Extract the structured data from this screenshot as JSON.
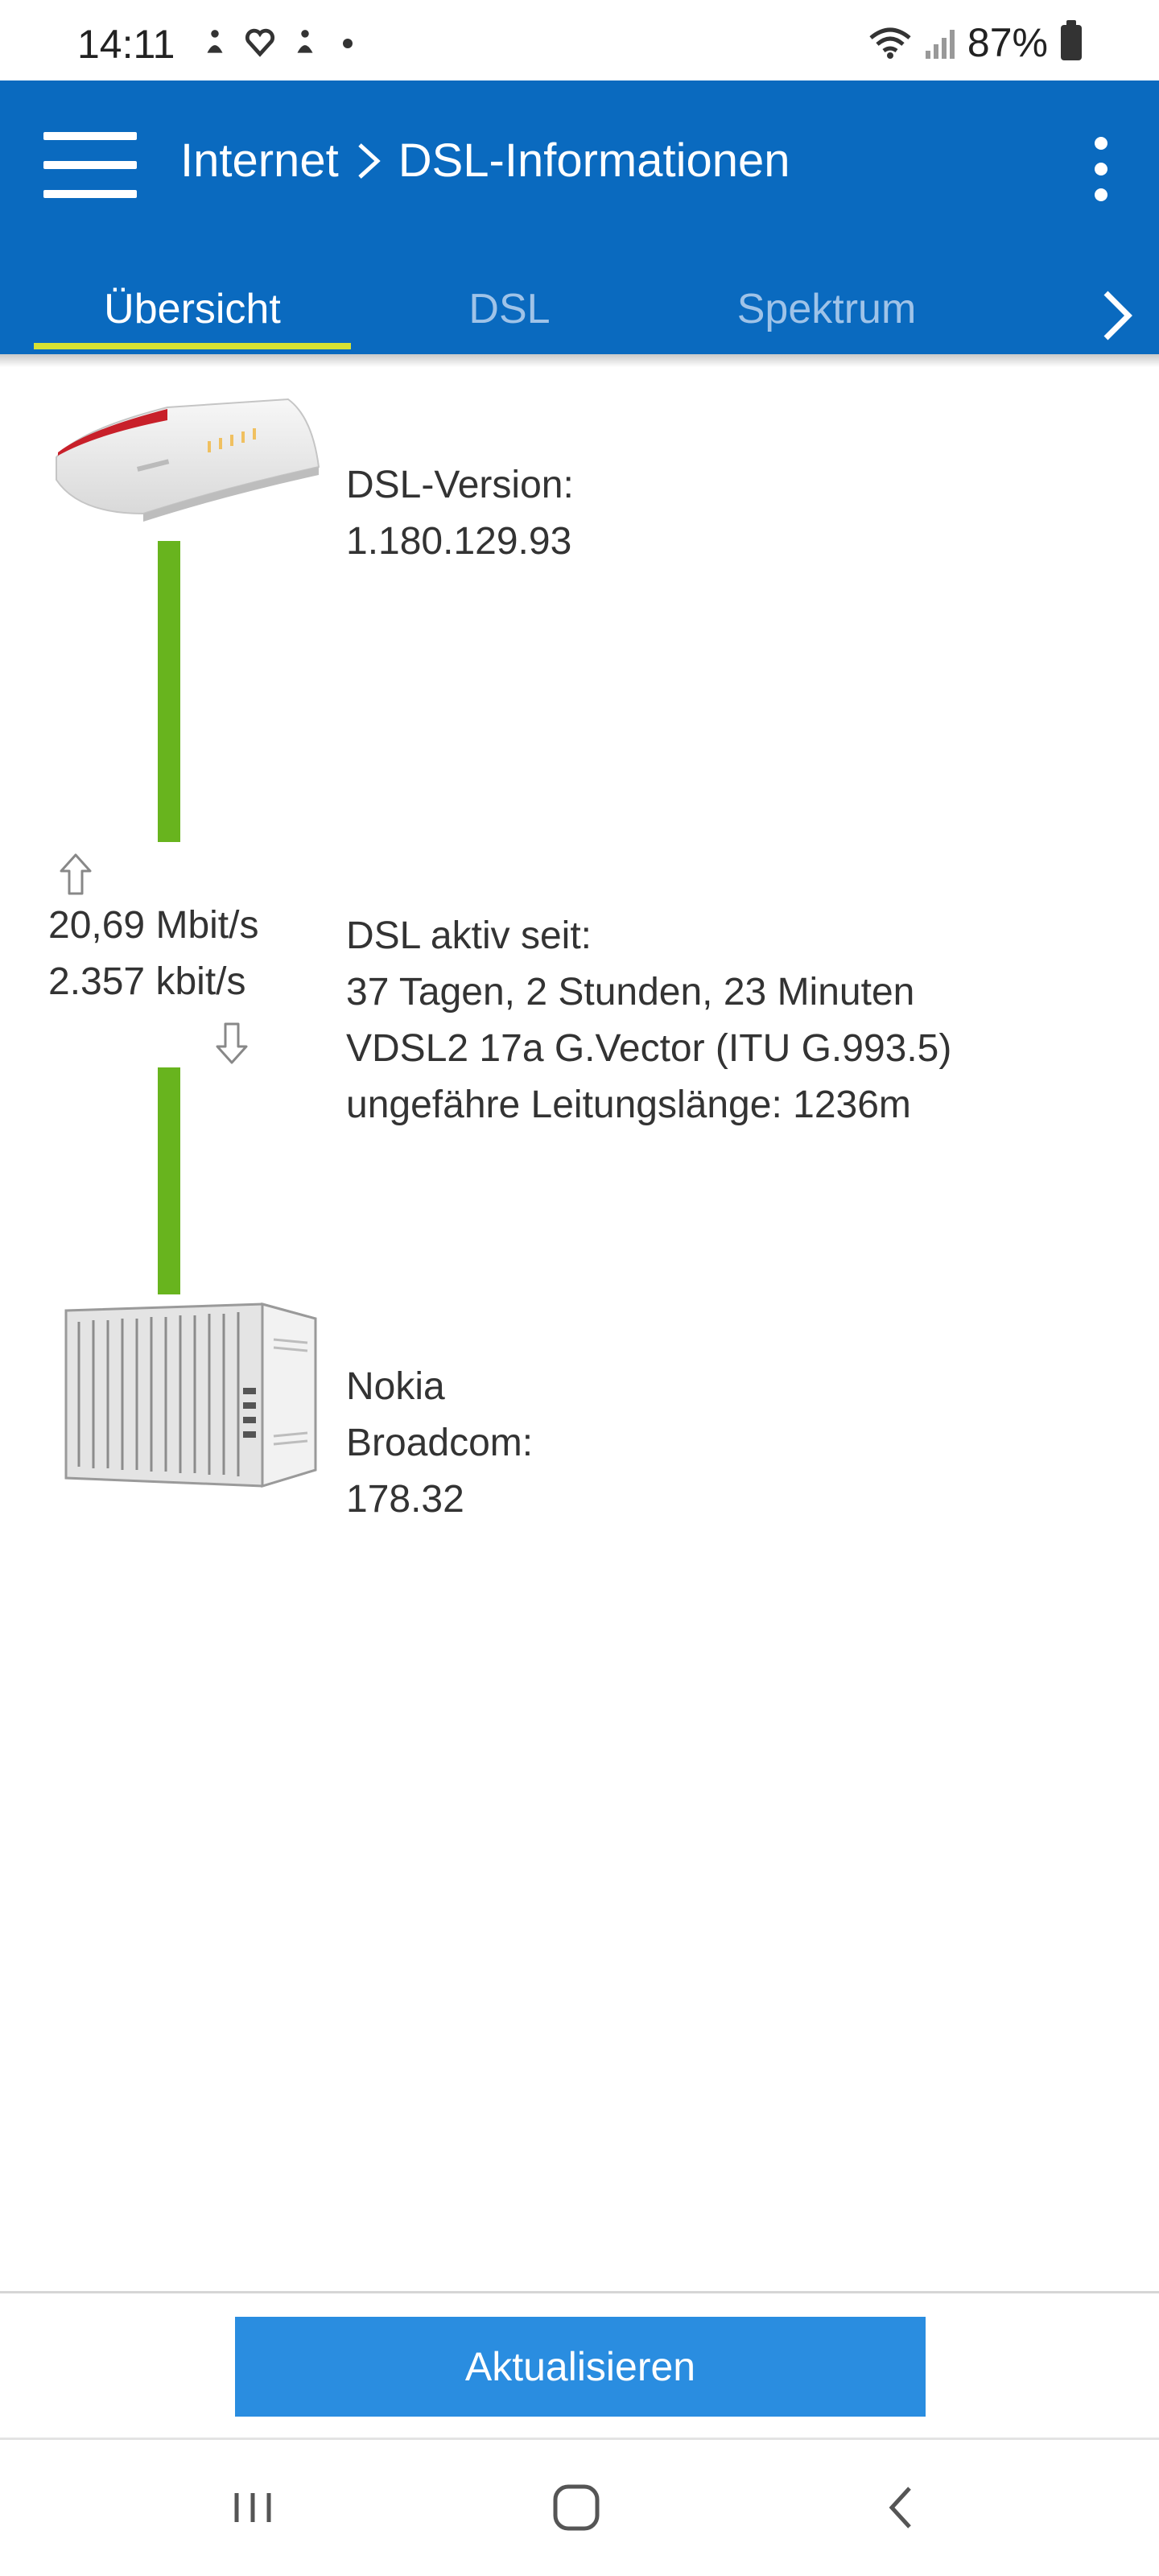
{
  "status_bar": {
    "time": "14:11",
    "battery": "87%",
    "icons": [
      "figure-icon",
      "heart-icon",
      "figure-icon",
      "dot-icon",
      "wifi-icon",
      "signal-icon",
      "battery-icon"
    ]
  },
  "app_bar": {
    "crumb_parent": "Internet",
    "crumb_current": "DSL-Informationen",
    "color": "#0a6abf"
  },
  "tabs": [
    {
      "label": "Übersicht",
      "active": true
    },
    {
      "label": "DSL",
      "active": false
    },
    {
      "label": "Spektrum",
      "active": false
    }
  ],
  "overview": {
    "dsl_version_label": "DSL-Version:",
    "dsl_version_value": "1.180.129.93",
    "upstream": "20,69 Mbit/s",
    "downstream": "2.357 kbit/s",
    "active_since_label": "DSL aktiv seit:",
    "active_since_value": "37 Tagen, 2 Stunden, 23 Minuten",
    "standard": "VDSL2 17a G.Vector (ITU G.993.5)",
    "line_length": "ungefähre Leitungslänge: 1236m",
    "dslam_vendor": "Nokia",
    "dslam_chip_label": "Broadcom:",
    "dslam_chip_version": "178.32",
    "line_color": "#68b41e"
  },
  "actions": {
    "refresh_label": "Aktualisieren",
    "refresh_color": "#2a8de0"
  }
}
